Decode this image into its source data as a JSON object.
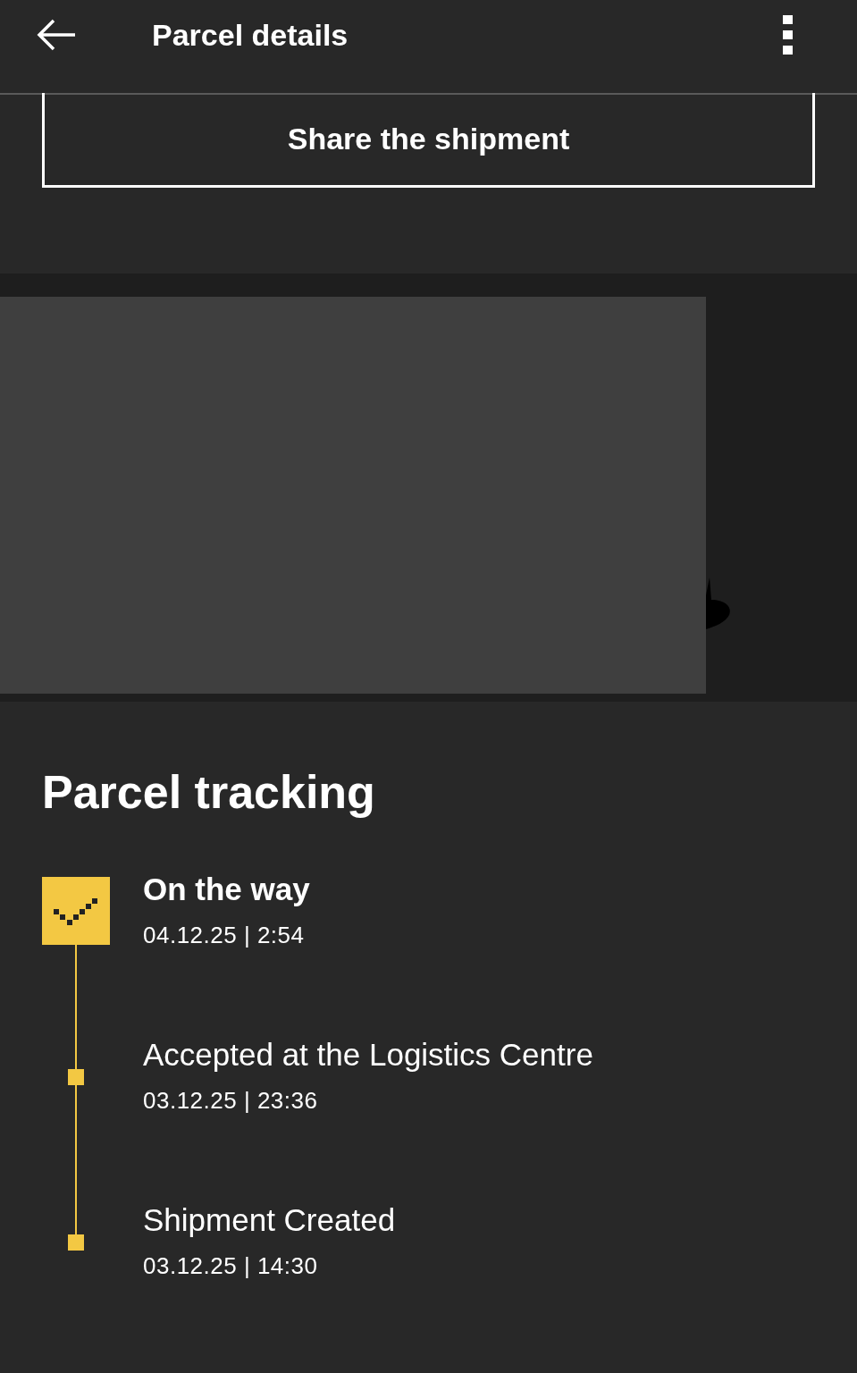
{
  "header": {
    "title": "Parcel details"
  },
  "share_button": {
    "label": "Share the shipment"
  },
  "tracking": {
    "title": "Parcel tracking",
    "events": [
      {
        "title": "On the way",
        "timestamp": "04.12.25 | 2:54",
        "current": true
      },
      {
        "title": "Accepted at the Logistics Centre",
        "timestamp": "03.12.25 | 23:36",
        "current": false
      },
      {
        "title": "Shipment Created",
        "timestamp": "03.12.25 | 14:30",
        "current": false
      }
    ]
  }
}
